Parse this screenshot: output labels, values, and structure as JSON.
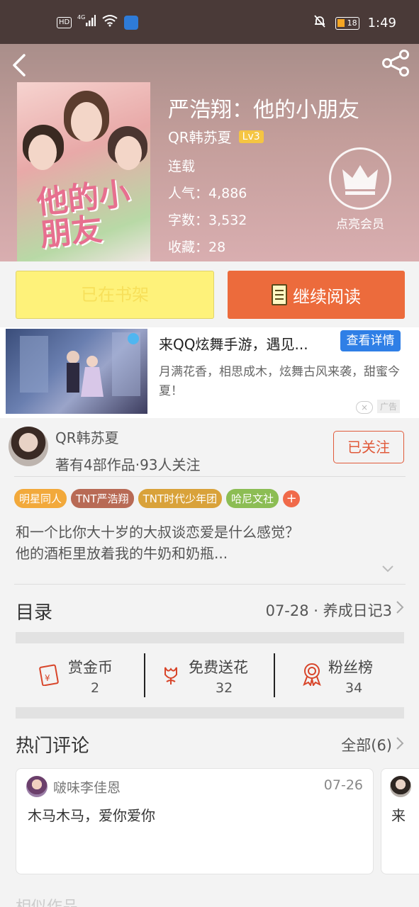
{
  "status_bar": {
    "hd": "HD",
    "network": "4G",
    "battery": "18",
    "time": "1:49"
  },
  "book": {
    "title": "严浩翔：他的小朋友",
    "author": "QR韩苏夏",
    "level": "Lv3",
    "status": "连载",
    "popularity": "人气：4,886",
    "word_count": "字数：3,532",
    "favorites": "收藏：28",
    "cover_art_text": "他的小朋友"
  },
  "vip": {
    "label": "点亮会员"
  },
  "actions": {
    "shelf_label": "已在书架",
    "read_label": "继续阅读"
  },
  "ad": {
    "title": "来QQ炫舞手游，遇见...",
    "button": "查看详情",
    "description": "月满花香，相思成木，炫舞古风来袭，甜蜜今夏！",
    "close": "×",
    "tag": "广告"
  },
  "author_card": {
    "name": "QR韩苏夏",
    "stats": "著有4部作品·93人关注",
    "follow_label": "已关注"
  },
  "tags": [
    {
      "label": "明星同人",
      "color": "#f2a93b"
    },
    {
      "label": "TNT严浩翔",
      "color": "#b86a55"
    },
    {
      "label": "TNT时代少年团",
      "color": "#d9a23a"
    },
    {
      "label": "哈尼文社",
      "color": "#8cbd54"
    }
  ],
  "synopsis": {
    "line1": "和一个比你大十岁的大叔谈恋爱是什么感觉？",
    "line2": "他的酒柜里放着我的牛奶和奶瓶..."
  },
  "toc": {
    "label": "目录",
    "latest": "07-28 · 养成日记3"
  },
  "stats": {
    "reward": {
      "label": "赏金币",
      "value": "2"
    },
    "flowers": {
      "label": "免费送花",
      "value": "32"
    },
    "fans": {
      "label": "粉丝榜",
      "value": "34"
    }
  },
  "comments": {
    "title": "热门评论",
    "all_label": "全部(6)",
    "items": [
      {
        "user": "啵味李佳恩",
        "date": "07-26",
        "text": "木马木马，爱你爱你"
      },
      {
        "text": "来"
      }
    ]
  },
  "similar": {
    "title": "相似作品"
  },
  "colors": {
    "accent": "#ec6b3c",
    "shelf": "#fef27a",
    "follow": "#e05a3a",
    "ad_button": "#2f7fe6"
  }
}
